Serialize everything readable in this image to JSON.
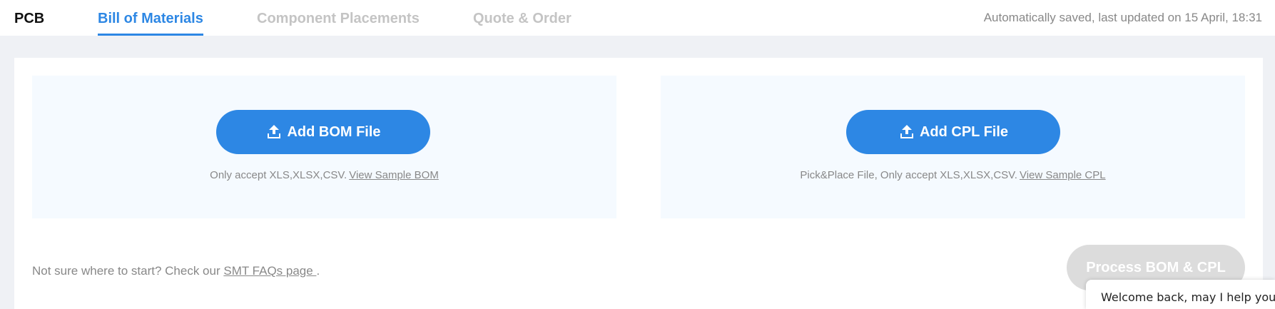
{
  "header": {
    "tabs": [
      {
        "label": "PCB"
      },
      {
        "label": "Bill of Materials",
        "active": true
      },
      {
        "label": "Component Placements"
      },
      {
        "label": "Quote & Order"
      }
    ],
    "saved_status": "Automatically saved, last updated on 15 April, 18:31"
  },
  "bom_panel": {
    "button_label": "Add BOM File",
    "icon": "upload-icon",
    "hint_text": "Only accept XLS,XLSX,CSV.",
    "sample_link": "View Sample BOM"
  },
  "cpl_panel": {
    "button_label": "Add CPL File",
    "icon": "upload-icon",
    "hint_text": "Pick&Place File, Only accept XLS,XLSX,CSV.",
    "sample_link": "View Sample CPL"
  },
  "footer": {
    "faq_prefix": "Not sure where to start? Check our",
    "faq_link": "SMT FAQs page ",
    "faq_suffix": ".",
    "process_button": "Process BOM & CPL"
  },
  "chat": {
    "text": "Welcome back, may I help you?"
  },
  "colors": {
    "accent": "#2d87e4",
    "disabled_button": "#dcdcdc",
    "panel_bg": "#f5faff",
    "page_bg": "#eff1f5"
  }
}
